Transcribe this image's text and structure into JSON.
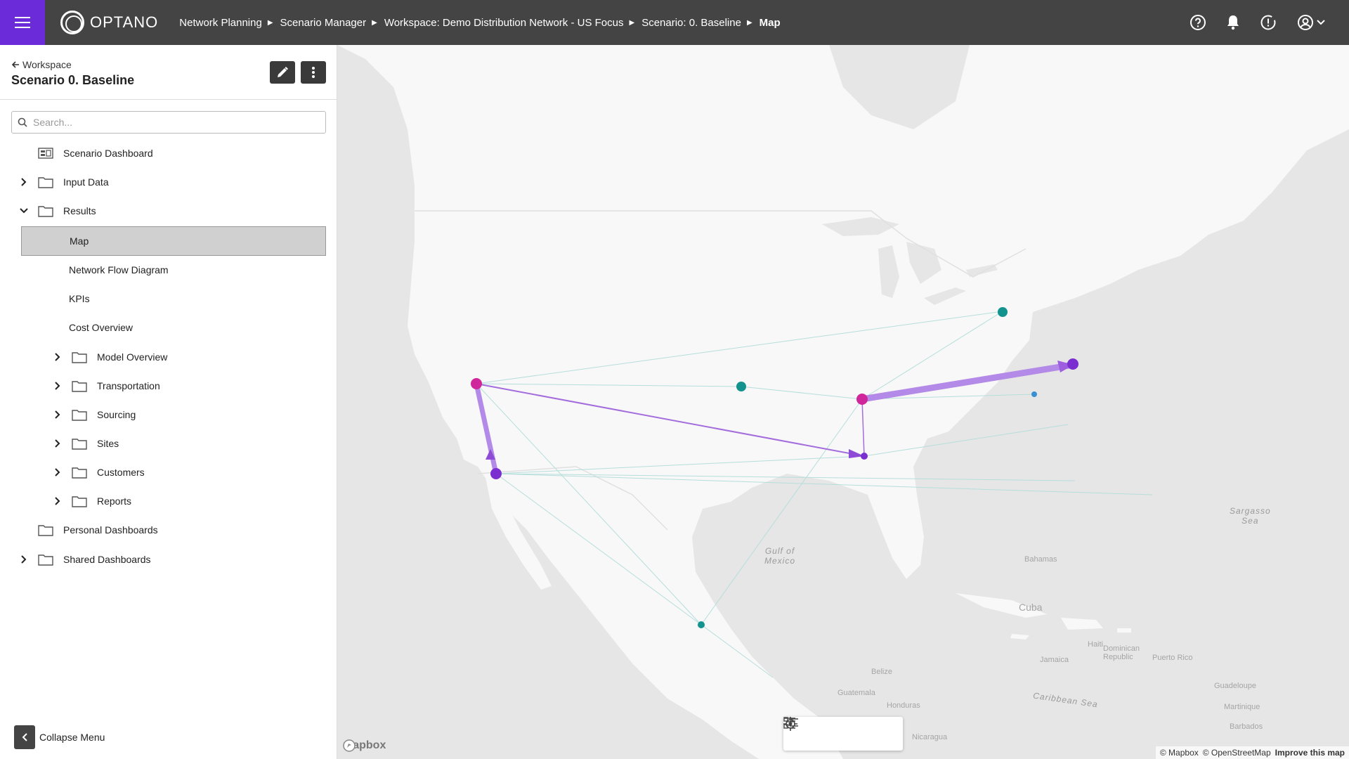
{
  "app": {
    "logo_text": "OPTANO"
  },
  "breadcrumb": [
    {
      "label": "Network Planning"
    },
    {
      "label": "Scenario Manager"
    },
    {
      "label": "Workspace: Demo Distribution Network - US Focus"
    },
    {
      "label": "Scenario: 0. Baseline"
    },
    {
      "label": "Map"
    }
  ],
  "sidebar": {
    "back_label": "Workspace",
    "title": "Scenario 0. Baseline",
    "search_placeholder": "Search...",
    "items": {
      "scenario_dashboard": "Scenario Dashboard",
      "input_data": "Input Data",
      "results": "Results",
      "map": "Map",
      "network_flow": "Network Flow Diagram",
      "kpis": "KPIs",
      "cost_overview": "Cost Overview",
      "model_overview": "Model Overview",
      "transportation": "Transportation",
      "sourcing": "Sourcing",
      "sites": "Sites",
      "customers": "Customers",
      "reports": "Reports",
      "personal_dashboards": "Personal Dashboards",
      "shared_dashboards": "Shared Dashboards"
    },
    "collapse_label": "Collapse Menu"
  },
  "map": {
    "labels": {
      "gulf": "Gulf of\nMexico",
      "sargasso": "Sargasso\nSea",
      "caribbean": "Caribbean Sea",
      "cuba": "Cuba",
      "bahamas": "Bahamas",
      "haiti": "Haiti",
      "dominican": "Dominican\nRepublic",
      "puerto_rico": "Puerto Rico",
      "jamaica": "Jamaica",
      "belize": "Belize",
      "guatemala": "Guatemala",
      "honduras": "Honduras",
      "nicaragua": "Nicaragua",
      "guadeloupe": "Guadeloupe",
      "martinique": "Martinique",
      "barbados": "Barbados"
    },
    "mapbox_logo": "mapbox",
    "attribution": {
      "mapbox": "© Mapbox",
      "osm": "© OpenStreetMap",
      "improve": "Improve this map"
    },
    "colors": {
      "factory": "#d0269b",
      "warehouse": "#7b2fd0",
      "customer": "#12938e",
      "flow": "#9f6ee0",
      "thin": "#b6dedb"
    }
  }
}
